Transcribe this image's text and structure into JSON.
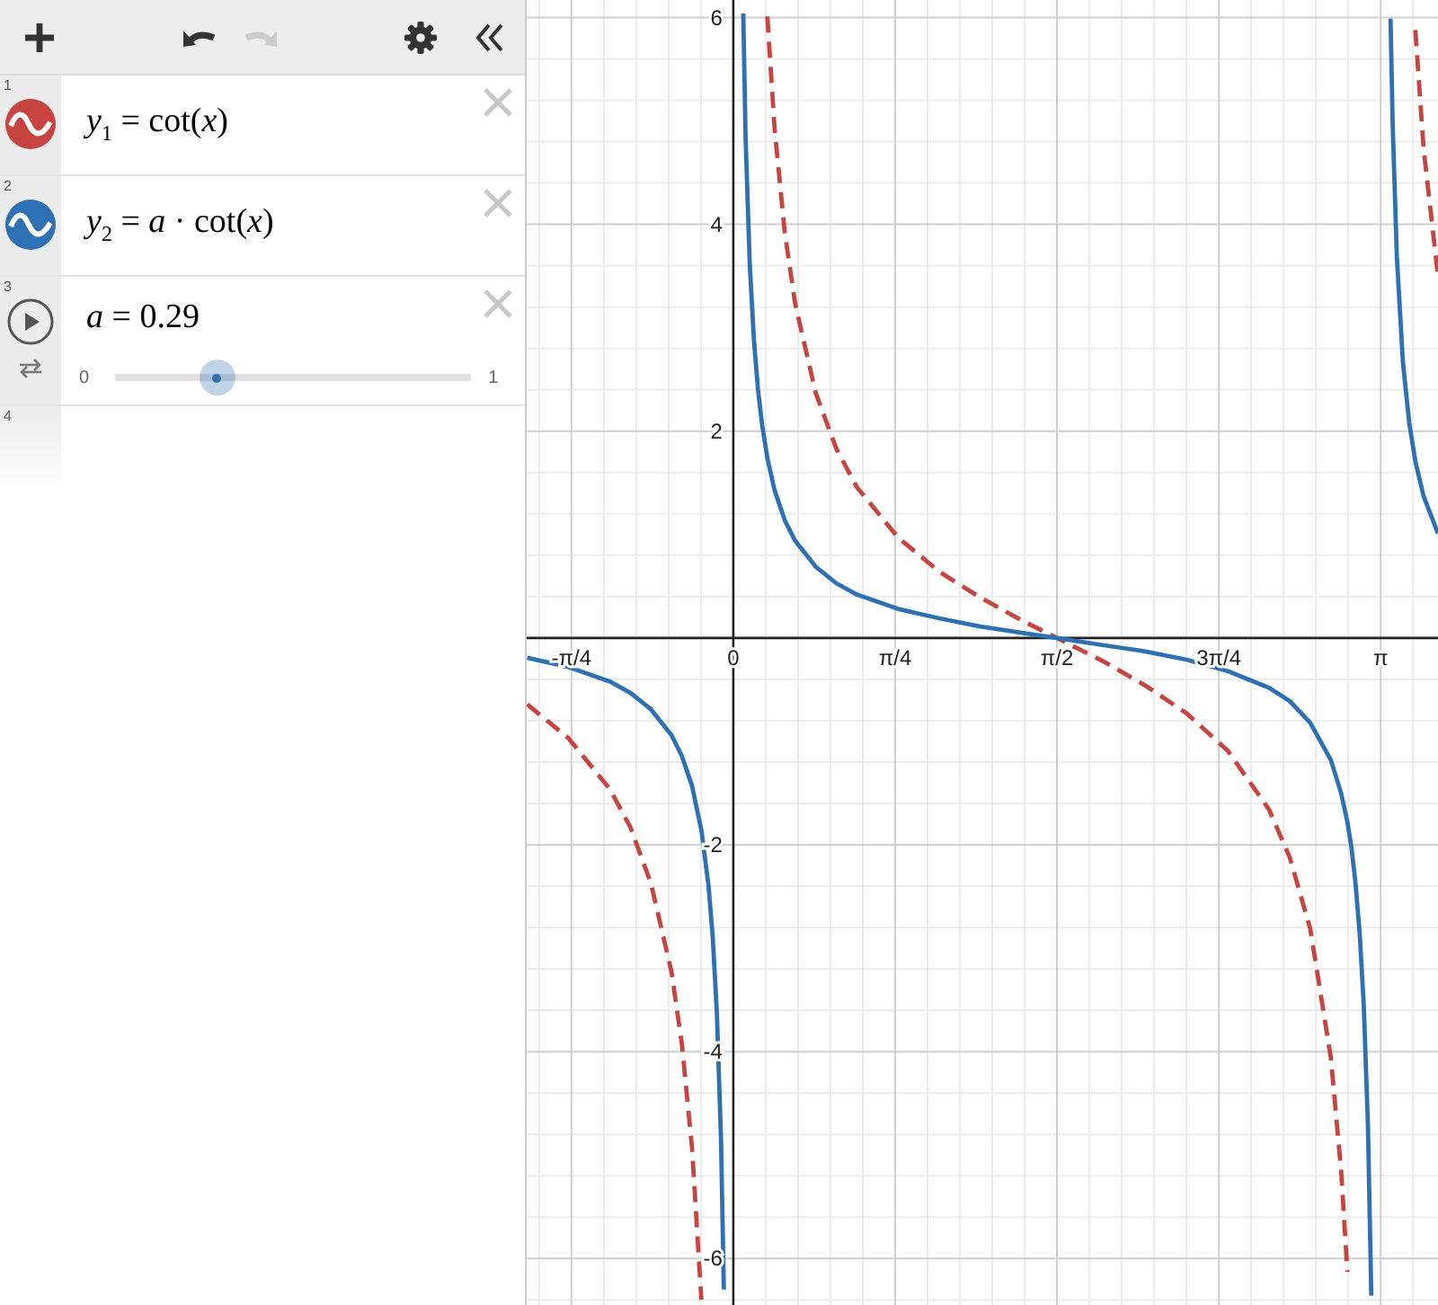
{
  "toolbar": {
    "undo": {
      "disabled": false
    },
    "redo": {
      "disabled": true
    }
  },
  "expressions": [
    {
      "index": "1",
      "kind": "expression",
      "color": "#c74440",
      "latex": "*y*$_{1}$ = cot(*x*)"
    },
    {
      "index": "2",
      "kind": "expression",
      "color": "#2d70b3",
      "latex": "*y*$_{2}$ = *a* · cot(*x*)"
    },
    {
      "index": "3",
      "kind": "slider",
      "latex": "*a* = 0.29",
      "min": "0",
      "max": "1",
      "level": 0.29
    },
    {
      "index": "4",
      "kind": "empty"
    }
  ],
  "graph": {
    "chart_data": {
      "type": "line",
      "x": [
        -1.0,
        -0.8,
        -0.6,
        -0.5,
        -0.4,
        -0.3,
        -0.25,
        -0.2,
        -0.155,
        -0.12,
        -0.1,
        -0.08,
        -0.06,
        -0.046,
        0,
        0.048,
        0.06,
        0.08,
        0.1,
        0.12,
        0.14,
        0.165,
        0.2,
        0.25,
        0.3,
        0.4,
        0.5,
        0.6,
        0.8,
        1.0,
        1.2,
        1.4,
        1.5708,
        1.8,
        2.0,
        2.2,
        2.4,
        2.6,
        2.7,
        2.8,
        2.9,
        2.95,
        2.98,
        3.0,
        3.02,
        3.04,
        3.06,
        3.08,
        3.096,
        3.1416,
        3.19,
        3.2,
        3.22,
        3.25,
        3.28,
        3.31,
        3.35,
        3.42
      ],
      "series": [
        {
          "color": "#c74440",
          "line_style": "dashed",
          "values": [
            -0.64,
            -0.97,
            -1.46,
            -1.83,
            -2.37,
            -3.23,
            -3.92,
            -4.93,
            -6.4,
            null,
            null,
            null,
            null,
            null,
            null,
            null,
            null,
            null,
            null,
            null,
            null,
            6.01,
            4.93,
            3.92,
            3.23,
            2.37,
            1.83,
            1.46,
            0.97,
            0.64,
            0.39,
            0.17,
            0,
            -0.23,
            -0.46,
            -0.73,
            -1.09,
            -1.66,
            -2.12,
            -2.81,
            -4.06,
            -5.15,
            -6.13,
            null,
            null,
            null,
            null,
            null,
            null,
            null,
            null,
            null,
            null,
            null,
            null,
            5.88,
            4.73,
            3.5
          ]
        },
        {
          "color": "#2d70b3",
          "line_style": "solid",
          "values": [
            -0.19,
            -0.28,
            -0.42,
            -0.53,
            -0.69,
            -0.94,
            -1.14,
            -1.43,
            -1.86,
            -2.4,
            -2.89,
            -3.62,
            -4.83,
            -6.3,
            null,
            6.04,
            4.83,
            3.62,
            2.89,
            2.4,
            2.06,
            1.74,
            1.43,
            1.14,
            0.94,
            0.69,
            0.53,
            0.42,
            0.28,
            0.19,
            0.11,
            0.05,
            0,
            -0.07,
            -0.13,
            -0.21,
            -0.32,
            -0.48,
            -0.61,
            -0.82,
            -1.18,
            -1.5,
            -1.78,
            -2.03,
            -2.37,
            -2.85,
            -3.55,
            -4.7,
            -6.36,
            null,
            5.99,
            4.96,
            3.69,
            2.66,
            2.08,
            1.71,
            1.37,
            1.01
          ]
        }
      ],
      "grid": true,
      "xlim": [
        -1.003,
        3.42
      ],
      "ylim": [
        -6.45,
        6.17
      ],
      "xticks": [
        {
          "value": -0.7854,
          "label": "-π/4"
        },
        {
          "value": 0,
          "label": "0"
        },
        {
          "value": 0.7854,
          "label": "π/4"
        },
        {
          "value": 1.5708,
          "label": "π/2"
        },
        {
          "value": 2.3562,
          "label": "3π/4"
        },
        {
          "value": 3.1416,
          "label": "π"
        }
      ],
      "yticks": [
        -6,
        -4,
        -2,
        2,
        4,
        6
      ]
    }
  }
}
